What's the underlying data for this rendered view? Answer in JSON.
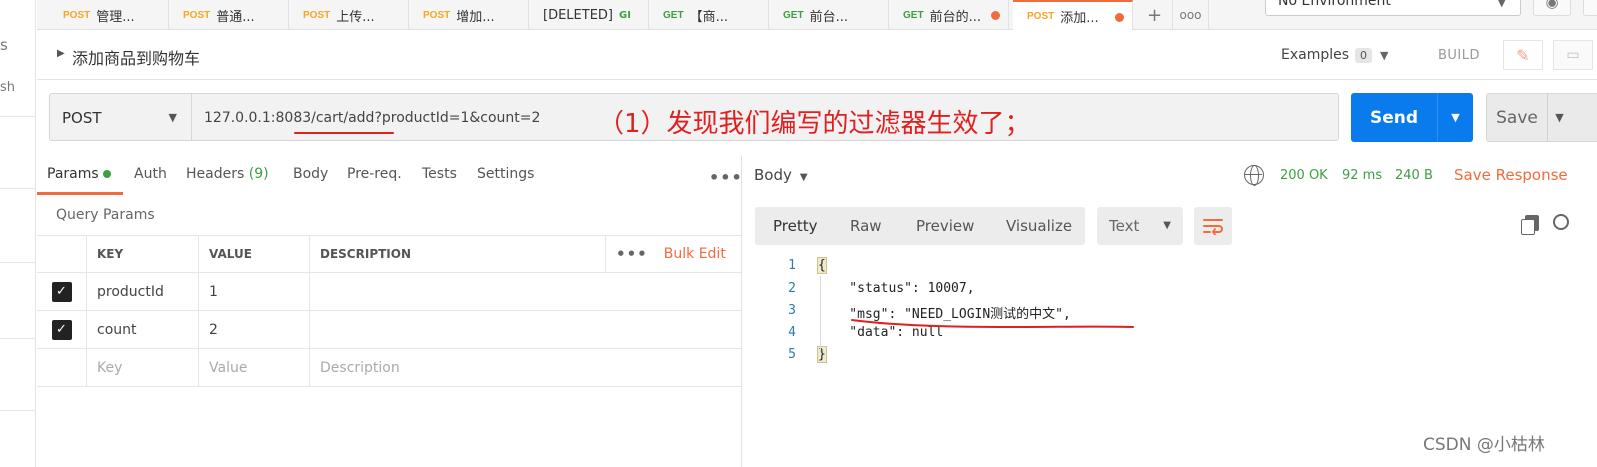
{
  "sidebar": {
    "fragments": [
      "s",
      "sh"
    ]
  },
  "tabs": [
    {
      "method": "POST",
      "label": "管理..."
    },
    {
      "method": "POST",
      "label": "普通..."
    },
    {
      "method": "POST",
      "label": "上传..."
    },
    {
      "method": "POST",
      "label": "增加..."
    },
    {
      "method": "",
      "label": "[DELETED]",
      "suffix": "GI"
    },
    {
      "method": "GET",
      "label": "【商..."
    },
    {
      "method": "GET",
      "label": "前台..."
    },
    {
      "method": "GET",
      "label": "前台的..."
    },
    {
      "method": "POST",
      "label": "添加..."
    }
  ],
  "environment": {
    "selected": "No Environment"
  },
  "request": {
    "name": "添加商品到购物车",
    "examples_label": "Examples",
    "examples_count": "0",
    "build_label": "BUILD",
    "method": "POST",
    "url": "127.0.0.1:8083/cart/add?productId=1&count=2",
    "annotation": "（1）发现我们编写的过滤器生效了；",
    "send_label": "Send",
    "save_label": "Save"
  },
  "req_tabs": {
    "params": "Params",
    "auth": "Auth",
    "headers": "Headers",
    "headers_count": "(9)",
    "body": "Body",
    "prereq": "Pre-req.",
    "tests": "Tests",
    "settings": "Settings"
  },
  "params": {
    "title": "Query Params",
    "columns": {
      "key": "KEY",
      "value": "VALUE",
      "description": "DESCRIPTION"
    },
    "bulk_edit": "Bulk Edit",
    "rows": [
      {
        "checked": true,
        "key": "productId",
        "value": "1",
        "description": ""
      },
      {
        "checked": true,
        "key": "count",
        "value": "2",
        "description": ""
      }
    ],
    "placeholder": {
      "key": "Key",
      "value": "Value",
      "description": "Description"
    }
  },
  "response": {
    "body_label": "Body",
    "status": "200 OK",
    "time": "92 ms",
    "size": "240 B",
    "save_response": "Save Response",
    "views": {
      "pretty": "Pretty",
      "raw": "Raw",
      "preview": "Preview",
      "visualize": "Visualize"
    },
    "format": "Text",
    "lines": [
      {
        "n": "1",
        "text": "{"
      },
      {
        "n": "2",
        "text": "    \"status\": 10007,"
      },
      {
        "n": "3",
        "text": "    \"msg\": \"NEED_LOGIN测试的中文\","
      },
      {
        "n": "4",
        "text": "    \"data\": null"
      },
      {
        "n": "5",
        "text": "}"
      }
    ]
  },
  "watermark": "CSDN @小枯林",
  "colors": {
    "accent": "#f26b3a",
    "send": "#097bed",
    "success": "#3c9f40",
    "annotation": "#e02020"
  }
}
